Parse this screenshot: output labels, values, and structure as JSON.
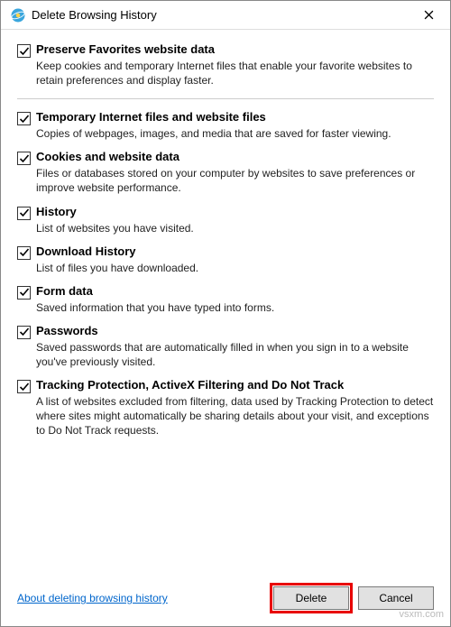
{
  "window": {
    "title": "Delete Browsing History"
  },
  "options": [
    {
      "id": "preserve-favorites",
      "checked": true,
      "label": "Preserve Favorites website data",
      "desc": "Keep cookies and temporary Internet files that enable your favorite websites to retain preferences and display faster."
    },
    {
      "id": "temp-files",
      "checked": true,
      "label": "Temporary Internet files and website files",
      "desc": "Copies of webpages, images, and media that are saved for faster viewing."
    },
    {
      "id": "cookies",
      "checked": true,
      "label": "Cookies and website data",
      "desc": "Files or databases stored on your computer by websites to save preferences or improve website performance."
    },
    {
      "id": "history",
      "checked": true,
      "label": "History",
      "desc": "List of websites you have visited."
    },
    {
      "id": "download-history",
      "checked": true,
      "label": "Download History",
      "desc": "List of files you have downloaded."
    },
    {
      "id": "form-data",
      "checked": true,
      "label": "Form data",
      "desc": "Saved information that you have typed into forms."
    },
    {
      "id": "passwords",
      "checked": true,
      "label": "Passwords",
      "desc": "Saved passwords that are automatically filled in when you sign in to a website you've previously visited."
    },
    {
      "id": "tracking-protection",
      "checked": true,
      "label": "Tracking Protection, ActiveX Filtering and Do Not Track",
      "desc": "A list of websites excluded from filtering, data used by Tracking Protection to detect where sites might automatically be sharing details about your visit, and exceptions to Do Not Track requests."
    }
  ],
  "footer": {
    "link": "About deleting browsing history",
    "delete": "Delete",
    "cancel": "Cancel"
  },
  "watermark": "vsxm.com"
}
